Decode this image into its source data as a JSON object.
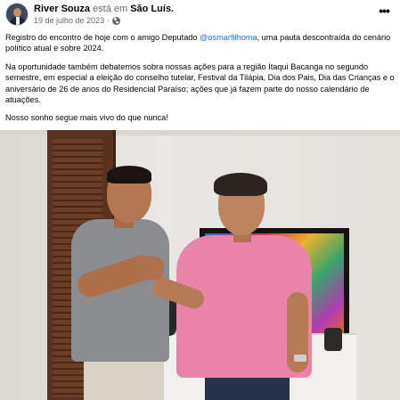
{
  "post": {
    "author": "River Souza",
    "action": " está em ",
    "location": "São Luís.",
    "date": "19 de julho de 2023",
    "date_separator": "·",
    "privacy_icon": "globe-icon",
    "more_icon": "more-options-icon",
    "more_label": "•••"
  },
  "text": {
    "p1_before": "Registro do encontro de hoje com o amigo Deputado ",
    "p1_mention": "@osmarfilhoma",
    "p1_after": ", uma pauta descontraída do cenário político atual e sobre 2024.",
    "p2": "Na oportunidade também debatemos sobra nossas ações para a região Itaqui Bacanga no segundo semestre, em especial a eleição do conselho tutelar, Festival da Tilápia, Dia dos Pais, Dia das Crianças e o aniversário de 26 de anos do Residencial Paraíso; ações que já fazem parte do nosso calendário de atuações.",
    "p3": "Nosso sonho segue mais vivo do que nunca!"
  },
  "colors": {
    "mention": "#216fdb",
    "text": "#050505",
    "meta": "#65676b",
    "shirt_right": "#ea83a8",
    "shirt_left": "#8a8c8f"
  }
}
